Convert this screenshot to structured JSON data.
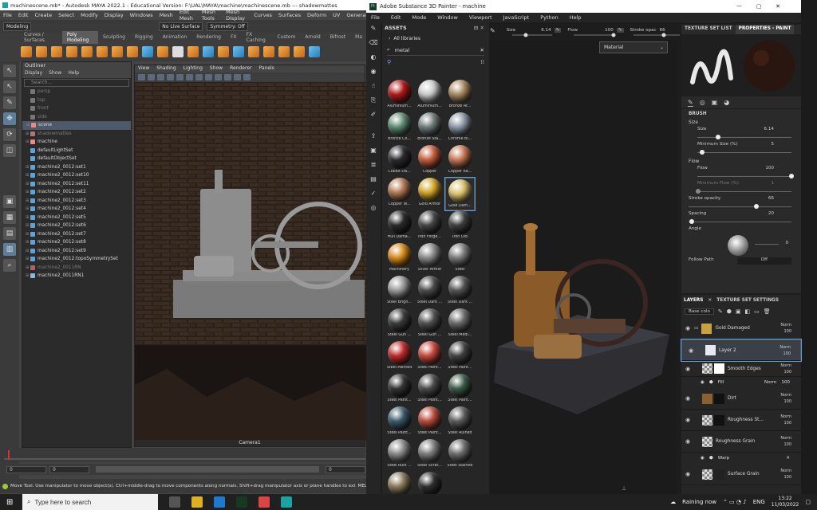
{
  "maya": {
    "title": "machinescene.mb* - Autodesk MAYA 2022.1 - Educational Version: F:\\UAL\\MAYA\\machine\\machinescene.mb --- shadowmattes",
    "menu": [
      "File",
      "Edit",
      "Create",
      "Select",
      "Modify",
      "Display",
      "Windows",
      "Mesh",
      "Edit Mesh",
      "Mesh Tools",
      "Mesh Display",
      "Curves",
      "Surfaces",
      "Deform",
      "UV",
      "General"
    ],
    "mode": "Modeling",
    "live_surface": "No Live Surface",
    "symmetry": "Symmetry: Off",
    "shelf_tabs": [
      "Curves / Surfaces",
      "Poly Modeling",
      "Sculpting",
      "Rigging",
      "Animation",
      "Rendering",
      "FX",
      "FX Caching",
      "Custom",
      "Arnold",
      "Bifrost",
      "Ma"
    ],
    "outliner": {
      "title": "Outliner",
      "menu": [
        "Display",
        "Show",
        "Help"
      ],
      "search_placeholder": "Search...",
      "items": [
        "persp",
        "top",
        "front",
        "side",
        "scene",
        "shadowmattes",
        "machine",
        "defaultLightSet",
        "defaultObjectSet",
        "machine2_0012:set1",
        "machine2_0012:set10",
        "machine2_0012:set11",
        "machine2_0012:set2",
        "machine2_0012:set3",
        "machine2_0012:set4",
        "machine2_0012:set5",
        "machine2_0012:set6",
        "machine2_0012:set7",
        "machine2_0012:set8",
        "machine2_0012:set9",
        "machine2_0012:topoSymmetrySet",
        "machine2_0011RN",
        "machine2_0011RN1"
      ]
    },
    "viewport_menu": [
      "View",
      "Shading",
      "Lighting",
      "Show",
      "Renderer",
      "Panels"
    ],
    "camera_label": "Camera1",
    "range_start": "0",
    "range_end": "0",
    "range_cur": "0",
    "help_text": "Move Tool: Use manipulator to move object(s). Ctrl+middle-drag to move components along normals. Shift+drag manipulator axis or plane handles to extrude components or c",
    "help_tag": "MEL"
  },
  "sp": {
    "title": "Adobe Substance 3D Painter - machine",
    "menu": [
      "File",
      "Edit",
      "Mode",
      "Window",
      "Viewport",
      "JavaScript",
      "Python",
      "Help"
    ],
    "assets": {
      "title": "ASSETS",
      "library": "All libraries",
      "search": "metal",
      "materials": [
        {
          "name": "Aluminium...",
          "color": "#b01818"
        },
        {
          "name": "Aluminium...",
          "color": "#c9c9c9"
        },
        {
          "name": "Bronze Ar...",
          "color": "#a88860"
        },
        {
          "name": "Bronze Co...",
          "color": "#5c8a72"
        },
        {
          "name": "Bronze Sta...",
          "color": "#6d7a78"
        },
        {
          "name": "Chrome Bl...",
          "color": "#8d97a8"
        },
        {
          "name": "Cobalt Da...",
          "color": "#2a2a2e"
        },
        {
          "name": "Copper",
          "color": "#c45c3a"
        },
        {
          "name": "Copper Ra...",
          "color": "#c77655"
        },
        {
          "name": "Copper W...",
          "color": "#b47a55"
        },
        {
          "name": "Gold Armor",
          "color": "#d4a828"
        },
        {
          "name": "Gold Dam...",
          "color": "#d8c06a"
        },
        {
          "name": "Hull Dama...",
          "color": "#2a2a2a"
        },
        {
          "name": "Iron Forge...",
          "color": "#444444"
        },
        {
          "name": "Iron Old",
          "color": "#3d3d3d"
        },
        {
          "name": "Machinery",
          "color": "#d88a1a"
        },
        {
          "name": "Silver Armor",
          "color": "#8a8a8a"
        },
        {
          "name": "Steel",
          "color": "#7a7a7a"
        },
        {
          "name": "Steel Brigh...",
          "color": "#9a9a9a"
        },
        {
          "name": "Steel Dark ...",
          "color": "#4a4a4a"
        },
        {
          "name": "Steel Dark ...",
          "color": "#525252"
        },
        {
          "name": "Steel Gun ...",
          "color": "#3a3a3a"
        },
        {
          "name": "Steel Gun ...",
          "color": "#4f4f4f"
        },
        {
          "name": "Steel Medi...",
          "color": "#6a6a6a"
        },
        {
          "name": "Steel Painted",
          "color": "#c02a2a"
        },
        {
          "name": "Steel Paint...",
          "color": "#c8473a"
        },
        {
          "name": "Steel Paint...",
          "color": "#404040"
        },
        {
          "name": "Steel Paint...",
          "color": "#333333"
        },
        {
          "name": "Steel Paint...",
          "color": "#4a4a4a"
        },
        {
          "name": "Steel Paint...",
          "color": "#3a5a4a"
        },
        {
          "name": "Steel Paint...",
          "color": "#3a5a6a"
        },
        {
          "name": "Steel Paint...",
          "color": "#b84a3a"
        },
        {
          "name": "Steel Ruined",
          "color": "#5a5a5a"
        },
        {
          "name": "Steel Rust ...",
          "color": "#8a8a8a"
        },
        {
          "name": "Steel Scrat...",
          "color": "#7c7c7c"
        },
        {
          "name": "Steel Stained",
          "color": "#6c6c6c"
        },
        {
          "name": "",
          "color": "#8a7a5a"
        },
        {
          "name": "",
          "color": "#2e2e2e"
        }
      ]
    },
    "toolbar": {
      "size_label": "Size",
      "size_value": "6.14",
      "flow_label": "Flow",
      "flow_value": "100",
      "stroke_label": "Stroke opac",
      "stroke_value": "66"
    },
    "material_select": "Material",
    "props": {
      "tab1": "TEXTURE SET LIST",
      "tab2": "PROPERTIES - PAINT",
      "brush": "BRUSH",
      "size_group": "Size",
      "size_label": "Size",
      "size_value": "6.14",
      "minsize_label": "Minimum Size (%)",
      "minsize_value": "5",
      "flow_group": "Flow",
      "flow_label": "Flow",
      "flow_value": "100",
      "minflow_label": "Minimum Flow (%)",
      "minflow_value": "1",
      "stroke_label": "Stroke opacity",
      "stroke_value": "66",
      "spacing_label": "Spacing",
      "spacing_value": "20",
      "angle_label": "Angle",
      "angle_value": "0",
      "follow_label": "Follow Path",
      "follow_value": "Off"
    },
    "layers": {
      "tab1": "LAYERS",
      "tab2": "TEXTURE SET SETTINGS",
      "channel": "Base colo",
      "rows": [
        {
          "name": "Gold Damaged",
          "blend": "Norm",
          "opacity": "100"
        },
        {
          "name": "Layer 2",
          "blend": "Norm",
          "opacity": "100"
        },
        {
          "name": "Smooth Edges",
          "blend": "Norm",
          "opacity": "100"
        },
        {
          "name": "Dirt",
          "blend": "Norm",
          "opacity": "100"
        },
        {
          "name": "Roughness St...",
          "blend": "Norm",
          "opacity": "100"
        },
        {
          "name": "Roughness Grain",
          "blend": "Norm",
          "opacity": "100"
        },
        {
          "name": "Surface Grain",
          "blend": "Norm",
          "opacity": "100"
        }
      ],
      "fill_label": "Fill",
      "fill_blend": "Norm",
      "fill_val": "100",
      "warp_label": "Warp"
    }
  },
  "taskbar": {
    "search": "Type here to search",
    "weather": "Raining now",
    "lang": "ENG",
    "time": "13:22",
    "date": "11/03/2022"
  }
}
